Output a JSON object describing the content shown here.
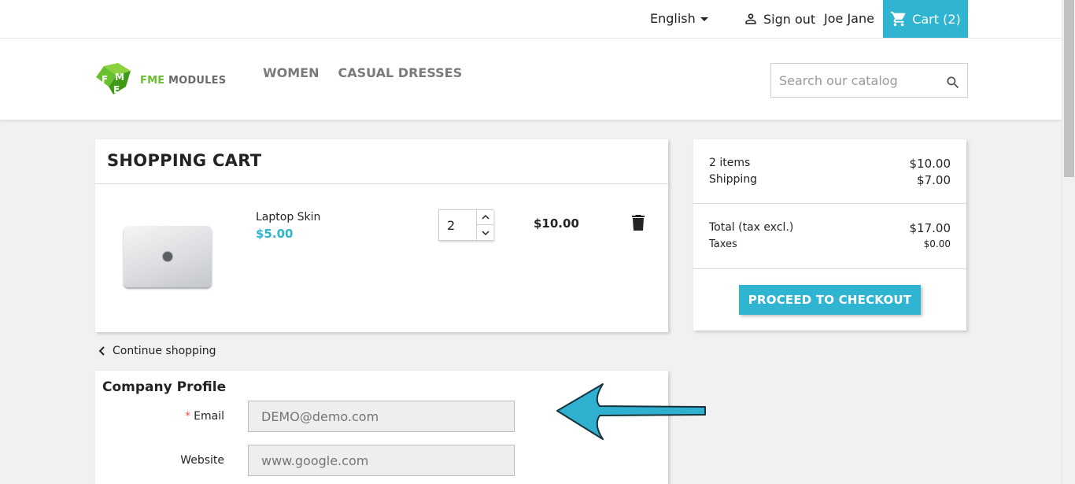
{
  "topbar": {
    "language": "English",
    "signout_label": "Sign out",
    "user_name": "Joe Jane",
    "cart_label": "Cart (2)"
  },
  "header": {
    "logo": {
      "word1": "FME",
      "word2": " MODULES"
    },
    "nav": [
      "WOMEN",
      "CASUAL DRESSES"
    ],
    "search_placeholder": "Search our catalog"
  },
  "cart": {
    "title": "SHOPPING CART",
    "item": {
      "name": "Laptop Skin",
      "unit_price": "$5.00",
      "quantity": "2",
      "line_total": "$10.00"
    },
    "continue_label": "Continue shopping"
  },
  "summary": {
    "items_label": "2 items",
    "items_amount": "$10.00",
    "shipping_label": "Shipping",
    "shipping_amount": "$7.00",
    "total_label": "Total (tax excl.)",
    "total_amount": "$17.00",
    "taxes_label": "Taxes",
    "taxes_amount": "$0.00",
    "checkout_label": "PROCEED TO CHECKOUT"
  },
  "profile": {
    "title": "Company Profile",
    "required_mark": "*",
    "email_label": "Email",
    "email_placeholder": "DEMO@demo.com",
    "website_label": "Website",
    "website_placeholder": "www.google.com"
  },
  "colors": {
    "accent": "#2fb5d2",
    "required": "#ff4c4c",
    "logo_green": "#6abf2f"
  },
  "icons": [
    "caret-down-icon",
    "person-icon",
    "cart-icon",
    "search-icon",
    "chevron-up-icon",
    "chevron-down-icon",
    "trash-icon",
    "chevron-left-icon",
    "arrow-left-icon"
  ]
}
